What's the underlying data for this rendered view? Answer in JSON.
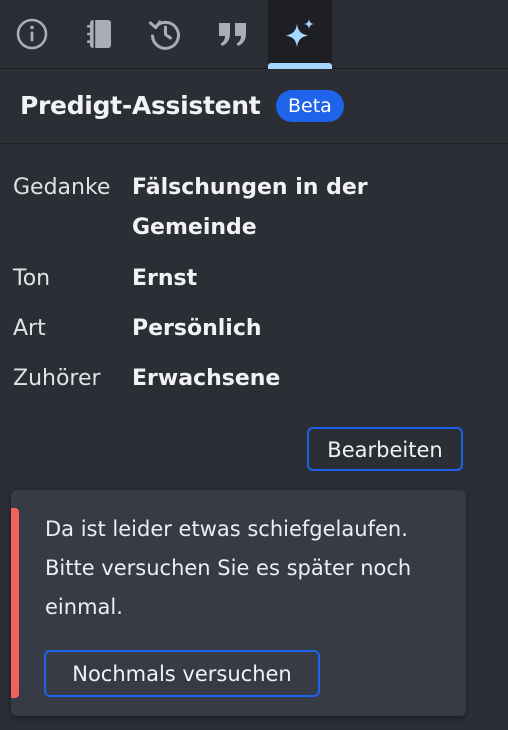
{
  "tabs": [
    {
      "id": "info",
      "icon": "info-circle-icon",
      "active": false
    },
    {
      "id": "notebook",
      "icon": "notebook-icon",
      "active": false
    },
    {
      "id": "history",
      "icon": "history-icon",
      "active": false
    },
    {
      "id": "quote",
      "icon": "quote-icon",
      "active": false
    },
    {
      "id": "ai",
      "icon": "sparkles-icon",
      "active": true
    }
  ],
  "panel": {
    "title": "Predigt-Assistent",
    "badge": "Beta"
  },
  "properties": [
    {
      "label": "Gedanke",
      "value": "Fälschungen in der Gemeinde"
    },
    {
      "label": "Ton",
      "value": "Ernst"
    },
    {
      "label": "Art",
      "value": "Persönlich"
    },
    {
      "label": "Zuhörer",
      "value": "Erwachsene"
    }
  ],
  "edit_button_label": "Bearbeiten",
  "error": {
    "message": "Da ist leider etwas schiefgelaufen. Bitte versuchen Sie es später noch einmal.",
    "retry_label": "Nochmals versuchen"
  },
  "colors": {
    "background": "#2b2e35",
    "accent": "#1e63e9",
    "active_tab_indicator": "#a6d8ff",
    "error_accent": "#f2615a",
    "card_background": "#373b45"
  }
}
